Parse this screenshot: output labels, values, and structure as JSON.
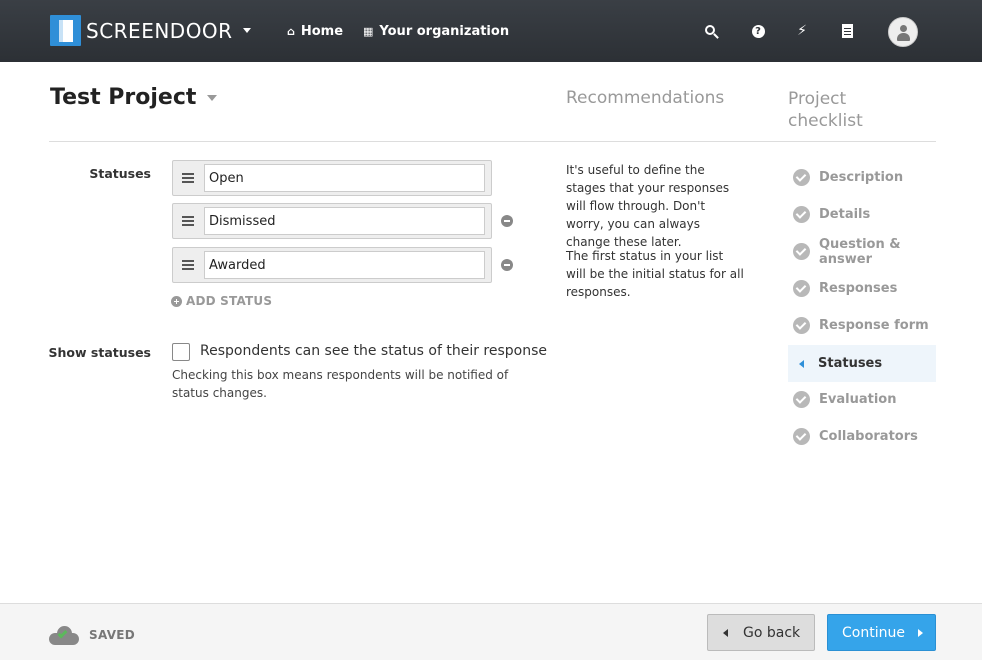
{
  "nav": {
    "brand": "SCREENDOOR",
    "home_label": "Home",
    "org_label": "Your organization",
    "icons": [
      "search-icon",
      "help-icon",
      "bolt-icon",
      "document-icon",
      "user-avatar"
    ]
  },
  "page": {
    "title": "Test Project",
    "recommendations_title": "Recommendations",
    "checklist_title": "Project checklist"
  },
  "form": {
    "statuses_label": "Statuses",
    "statuses": [
      {
        "value": "Open"
      },
      {
        "value": "Dismissed"
      },
      {
        "value": "Awarded"
      }
    ],
    "add_status_label": "ADD STATUS",
    "show_statuses_label": "Show statuses",
    "show_statuses_checked": false,
    "show_statuses_checkbox_label": "Respondents can see the status of their response",
    "show_statuses_help": "Checking this box means respondents will be notified of status changes."
  },
  "recommendations": [
    "It's useful to define the stages that your responses will flow through. Don't worry, you can always change these later.",
    "The first status in your list will be the initial status for all responses."
  ],
  "checklist": [
    {
      "label": "Description",
      "done": true
    },
    {
      "label": "Details",
      "done": true
    },
    {
      "label": "Question & answer",
      "done": true
    },
    {
      "label": "Responses",
      "done": true
    },
    {
      "label": "Response form",
      "done": true
    },
    {
      "label": "Statuses",
      "active": true
    },
    {
      "label": "Evaluation",
      "done": true
    },
    {
      "label": "Collaborators",
      "done": true
    }
  ],
  "footer": {
    "saved_label": "SAVED",
    "back_label": "Go back",
    "continue_label": "Continue"
  },
  "colors": {
    "accent": "#35a4ea",
    "nav_bg": "#2c3035",
    "saved_check": "#5cb85c"
  }
}
